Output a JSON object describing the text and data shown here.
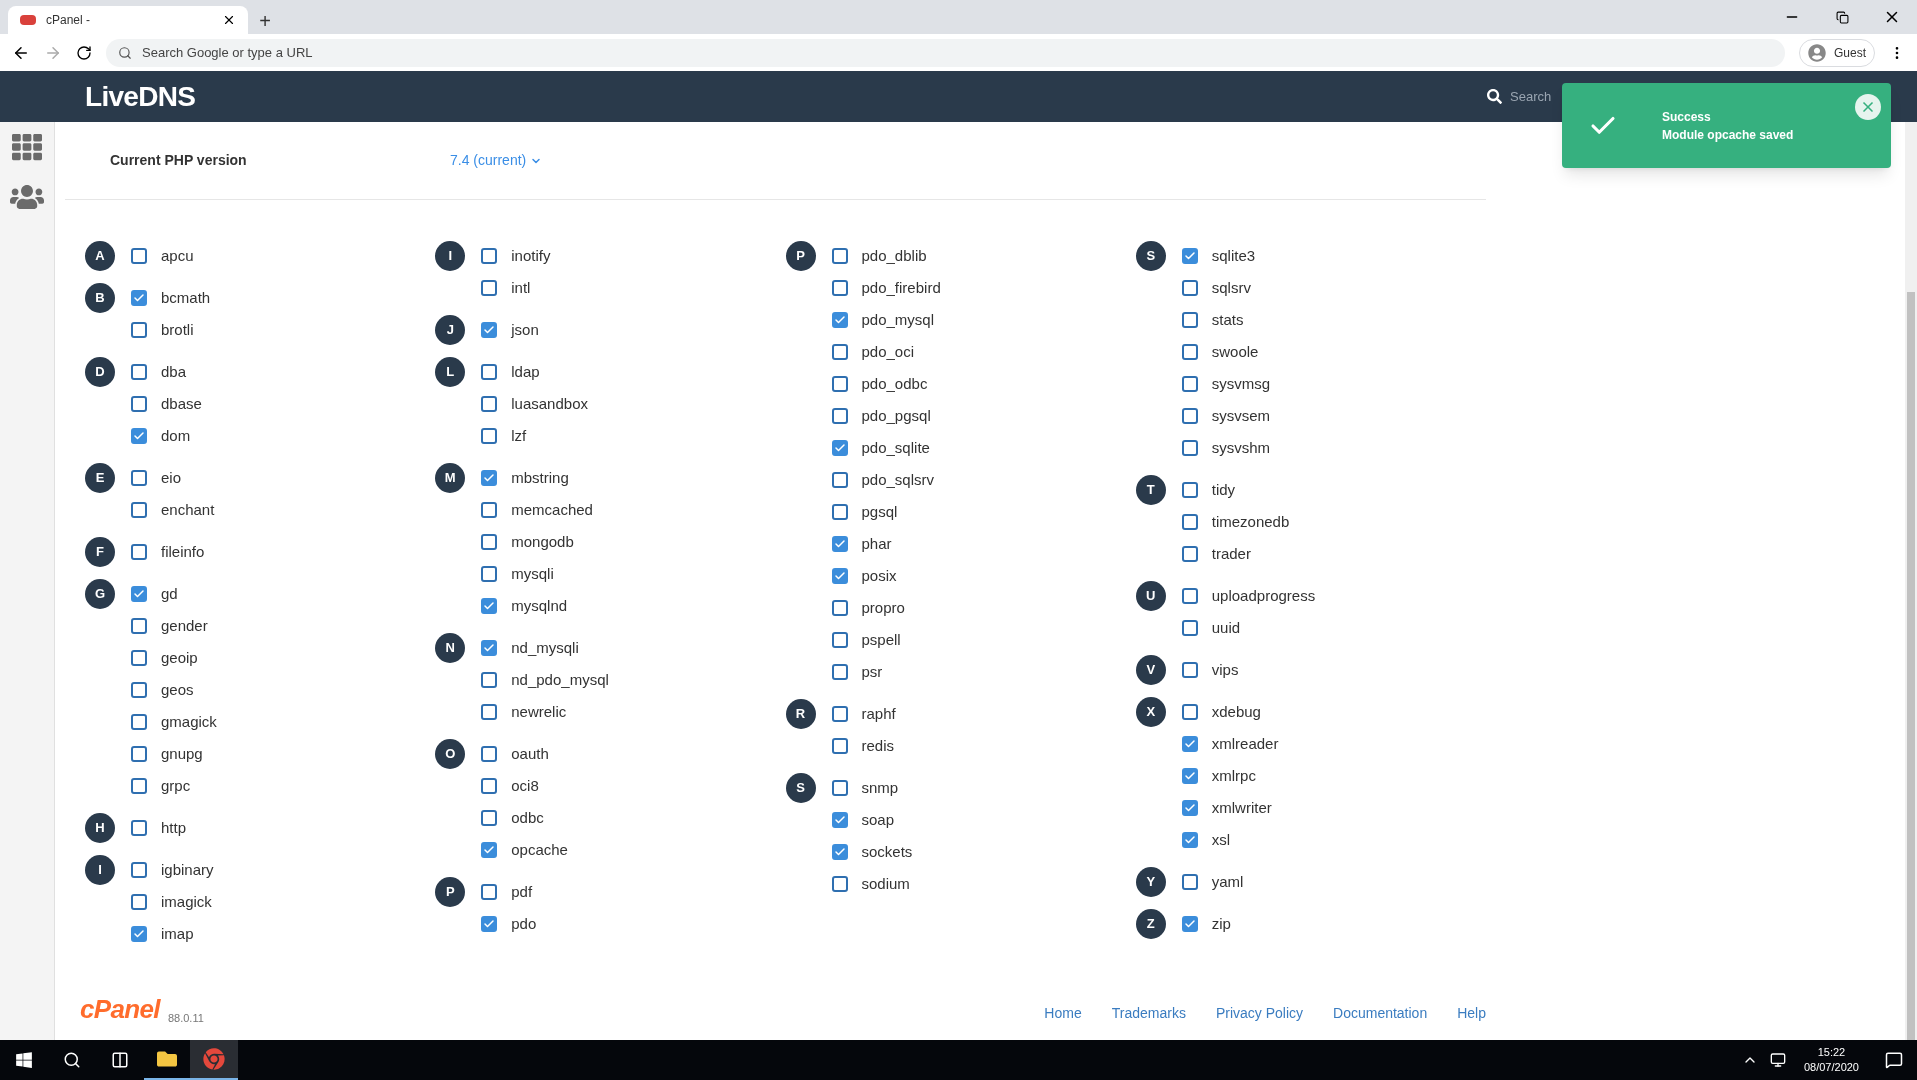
{
  "browser": {
    "tab_title": "cPanel -",
    "new_tab": "+",
    "address_placeholder": "Search Google or type a URL",
    "profile": "Guest"
  },
  "header": {
    "logo": "LiveDNS",
    "search_placeholder": "Search"
  },
  "toast": {
    "title": "Success",
    "message": "Module opcache saved"
  },
  "php_version": {
    "label": "Current PHP version",
    "value": "7.4 (current)"
  },
  "columns": [
    {
      "groups": [
        {
          "letter": "A",
          "modules": [
            {
              "name": "apcu",
              "checked": false
            }
          ]
        },
        {
          "letter": "B",
          "modules": [
            {
              "name": "bcmath",
              "checked": true
            },
            {
              "name": "brotli",
              "checked": false
            }
          ]
        },
        {
          "letter": "D",
          "modules": [
            {
              "name": "dba",
              "checked": false
            },
            {
              "name": "dbase",
              "checked": false
            },
            {
              "name": "dom",
              "checked": true
            }
          ]
        },
        {
          "letter": "E",
          "modules": [
            {
              "name": "eio",
              "checked": false
            },
            {
              "name": "enchant",
              "checked": false
            }
          ]
        },
        {
          "letter": "F",
          "modules": [
            {
              "name": "fileinfo",
              "checked": false
            }
          ]
        },
        {
          "letter": "G",
          "modules": [
            {
              "name": "gd",
              "checked": true
            },
            {
              "name": "gender",
              "checked": false
            },
            {
              "name": "geoip",
              "checked": false
            },
            {
              "name": "geos",
              "checked": false
            },
            {
              "name": "gmagick",
              "checked": false
            },
            {
              "name": "gnupg",
              "checked": false
            },
            {
              "name": "grpc",
              "checked": false
            }
          ]
        },
        {
          "letter": "H",
          "modules": [
            {
              "name": "http",
              "checked": false
            }
          ]
        },
        {
          "letter": "I",
          "modules": [
            {
              "name": "igbinary",
              "checked": false
            },
            {
              "name": "imagick",
              "checked": false
            },
            {
              "name": "imap",
              "checked": true
            }
          ]
        }
      ]
    },
    {
      "groups": [
        {
          "letter": "I",
          "modules": [
            {
              "name": "inotify",
              "checked": false
            },
            {
              "name": "intl",
              "checked": false
            }
          ]
        },
        {
          "letter": "J",
          "modules": [
            {
              "name": "json",
              "checked": true
            }
          ]
        },
        {
          "letter": "L",
          "modules": [
            {
              "name": "ldap",
              "checked": false
            },
            {
              "name": "luasandbox",
              "checked": false
            },
            {
              "name": "lzf",
              "checked": false
            }
          ]
        },
        {
          "letter": "M",
          "modules": [
            {
              "name": "mbstring",
              "checked": true
            },
            {
              "name": "memcached",
              "checked": false
            },
            {
              "name": "mongodb",
              "checked": false
            },
            {
              "name": "mysqli",
              "checked": false
            },
            {
              "name": "mysqlnd",
              "checked": true
            }
          ]
        },
        {
          "letter": "N",
          "modules": [
            {
              "name": "nd_mysqli",
              "checked": true
            },
            {
              "name": "nd_pdo_mysql",
              "checked": false
            },
            {
              "name": "newrelic",
              "checked": false
            }
          ]
        },
        {
          "letter": "O",
          "modules": [
            {
              "name": "oauth",
              "checked": false
            },
            {
              "name": "oci8",
              "checked": false
            },
            {
              "name": "odbc",
              "checked": false
            },
            {
              "name": "opcache",
              "checked": true
            }
          ]
        },
        {
          "letter": "P",
          "modules": [
            {
              "name": "pdf",
              "checked": false
            },
            {
              "name": "pdo",
              "checked": true
            }
          ]
        }
      ]
    },
    {
      "groups": [
        {
          "letter": "P",
          "modules": [
            {
              "name": "pdo_dblib",
              "checked": false
            },
            {
              "name": "pdo_firebird",
              "checked": false
            },
            {
              "name": "pdo_mysql",
              "checked": true
            },
            {
              "name": "pdo_oci",
              "checked": false
            },
            {
              "name": "pdo_odbc",
              "checked": false
            },
            {
              "name": "pdo_pgsql",
              "checked": false
            },
            {
              "name": "pdo_sqlite",
              "checked": true
            },
            {
              "name": "pdo_sqlsrv",
              "checked": false
            },
            {
              "name": "pgsql",
              "checked": false
            },
            {
              "name": "phar",
              "checked": true
            },
            {
              "name": "posix",
              "checked": true
            },
            {
              "name": "propro",
              "checked": false
            },
            {
              "name": "pspell",
              "checked": false
            },
            {
              "name": "psr",
              "checked": false
            }
          ]
        },
        {
          "letter": "R",
          "modules": [
            {
              "name": "raphf",
              "checked": false
            },
            {
              "name": "redis",
              "checked": false
            }
          ]
        },
        {
          "letter": "S",
          "modules": [
            {
              "name": "snmp",
              "checked": false
            },
            {
              "name": "soap",
              "checked": true
            },
            {
              "name": "sockets",
              "checked": true
            },
            {
              "name": "sodium",
              "checked": false
            }
          ]
        }
      ]
    },
    {
      "groups": [
        {
          "letter": "S",
          "modules": [
            {
              "name": "sqlite3",
              "checked": true
            },
            {
              "name": "sqlsrv",
              "checked": false
            },
            {
              "name": "stats",
              "checked": false
            },
            {
              "name": "swoole",
              "checked": false
            },
            {
              "name": "sysvmsg",
              "checked": false
            },
            {
              "name": "sysvsem",
              "checked": false
            },
            {
              "name": "sysvshm",
              "checked": false
            }
          ]
        },
        {
          "letter": "T",
          "modules": [
            {
              "name": "tidy",
              "checked": false
            },
            {
              "name": "timezonedb",
              "checked": false
            },
            {
              "name": "trader",
              "checked": false
            }
          ]
        },
        {
          "letter": "U",
          "modules": [
            {
              "name": "uploadprogress",
              "checked": false
            },
            {
              "name": "uuid",
              "checked": false
            }
          ]
        },
        {
          "letter": "V",
          "modules": [
            {
              "name": "vips",
              "checked": false
            }
          ]
        },
        {
          "letter": "X",
          "modules": [
            {
              "name": "xdebug",
              "checked": false
            },
            {
              "name": "xmlreader",
              "checked": true
            },
            {
              "name": "xmlrpc",
              "checked": true
            },
            {
              "name": "xmlwriter",
              "checked": true
            },
            {
              "name": "xsl",
              "checked": true
            }
          ]
        },
        {
          "letter": "Y",
          "modules": [
            {
              "name": "yaml",
              "checked": false
            }
          ]
        },
        {
          "letter": "Z",
          "modules": [
            {
              "name": "zip",
              "checked": true
            }
          ]
        }
      ]
    }
  ],
  "footer": {
    "logo": "cPanel",
    "version": "88.0.11",
    "links": [
      "Home",
      "Trademarks",
      "Privacy Policy",
      "Documentation",
      "Help"
    ]
  },
  "taskbar": {
    "time": "15:22",
    "date": "08/07/2020"
  }
}
